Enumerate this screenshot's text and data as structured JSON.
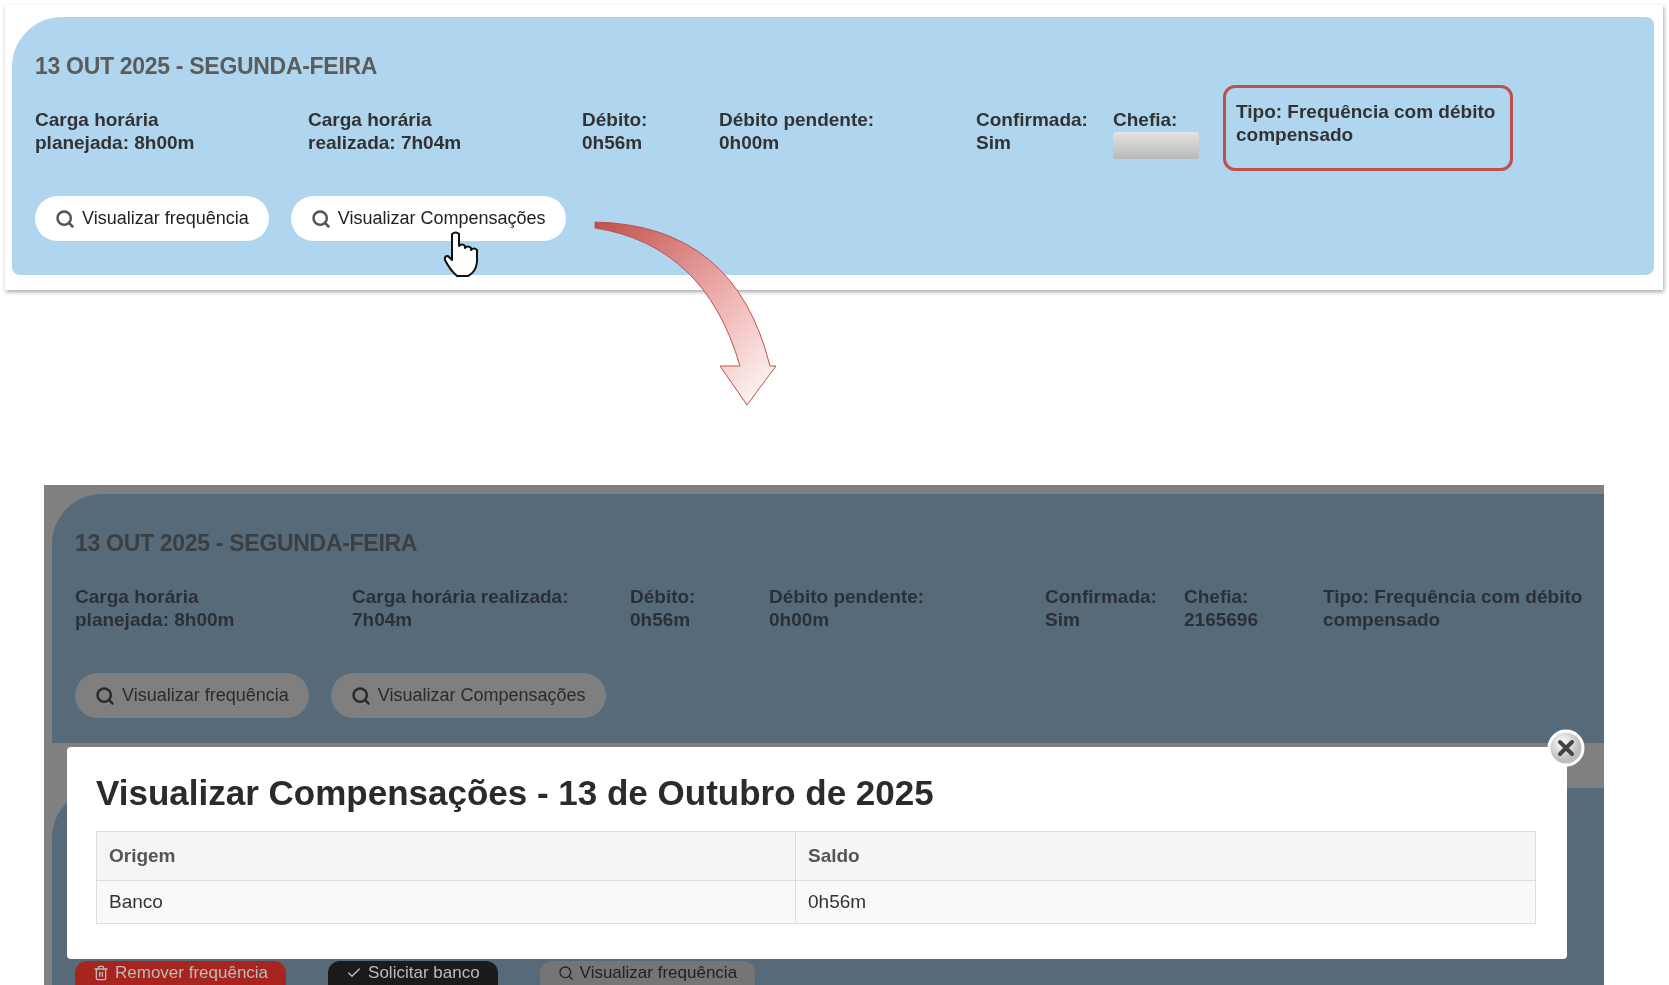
{
  "before": {
    "day_title": "13 OUT 2025 - SEGUNDA-FEIRA",
    "fields": [
      {
        "kind": "text",
        "lines": [
          "Carga horária",
          "planejada: 8h00m"
        ],
        "highlighted": false
      },
      {
        "kind": "text",
        "lines": [
          "Carga horária",
          "realizada: 7h04m"
        ],
        "highlighted": false
      },
      {
        "kind": "text",
        "lines": [
          "Débito:",
          "0h56m"
        ],
        "highlighted": false
      },
      {
        "kind": "text",
        "lines": [
          "Débito pendente:",
          "0h00m"
        ],
        "highlighted": false
      },
      {
        "kind": "text",
        "lines": [
          "Confirmada:",
          "Sim"
        ],
        "highlighted": false
      },
      {
        "kind": "hidden",
        "lines": [
          "Chefia:"
        ],
        "highlighted": false
      },
      {
        "kind": "text",
        "lines": [
          "Tipo: Frequência com débito",
          "compensado"
        ],
        "highlighted": true
      }
    ],
    "buttons": [
      "Visualizar frequência",
      "Visualizar Compensações"
    ]
  },
  "after": {
    "day_title": "13 OUT 2025 - SEGUNDA-FEIRA",
    "fields": [
      {
        "kind": "text",
        "lines": [
          "Carga horária",
          "planejada: 8h00m"
        ]
      },
      {
        "kind": "text",
        "lines": [
          "Carga horária realizada:",
          "7h04m"
        ]
      },
      {
        "kind": "text",
        "lines": [
          "Débito:",
          "0h56m"
        ]
      },
      {
        "kind": "text",
        "lines": [
          "Débito pendente:",
          "0h00m"
        ]
      },
      {
        "kind": "text",
        "lines": [
          "Confirmada:",
          "Sim"
        ]
      },
      {
        "kind": "text",
        "lines": [
          "Chefia:",
          "2165696"
        ]
      },
      {
        "kind": "text",
        "lines": [
          "Tipo: Frequência com débito",
          "compensado"
        ]
      }
    ],
    "buttons": [
      "Visualizar frequência",
      "Visualizar Compensações"
    ],
    "modal": {
      "title": "Visualizar Compensações - 13 de Outubro de 2025",
      "columns": [
        "Origem",
        "Saldo"
      ],
      "rows": [
        [
          "Banco",
          "0h56m"
        ]
      ]
    },
    "next_card_buttons": [
      {
        "kind": "danger",
        "label": "Remover frequência"
      },
      {
        "kind": "dark",
        "label": "Solicitar banco"
      },
      {
        "kind": "light",
        "label": "Visualizar frequência"
      }
    ]
  }
}
